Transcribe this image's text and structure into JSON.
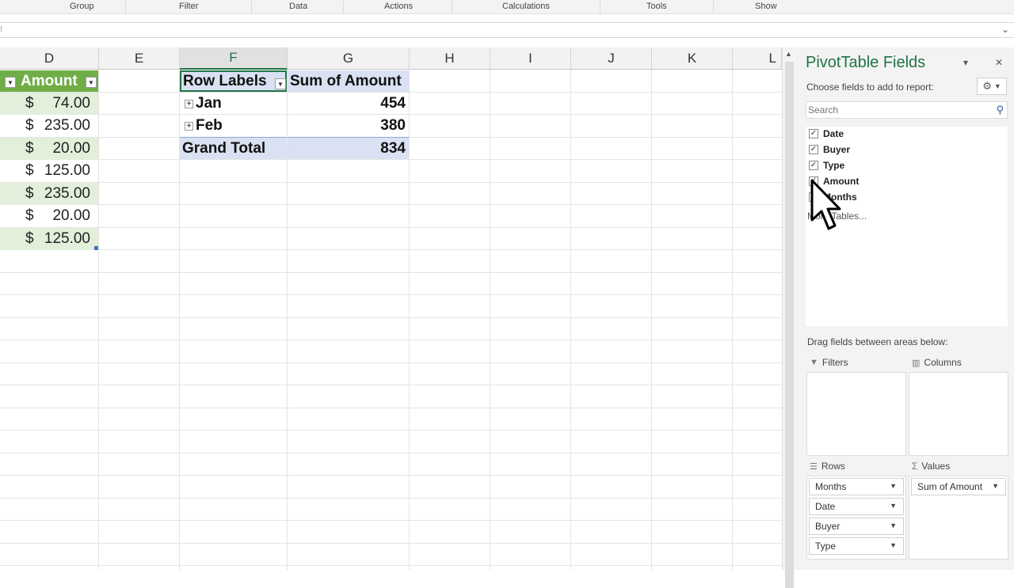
{
  "ribbon": {
    "groups": [
      "Group",
      "Filter",
      "Data",
      "Actions",
      "Calculations",
      "Tools",
      "Show"
    ]
  },
  "formula_bar": {
    "chevron": "⌄"
  },
  "columns": [
    "D",
    "E",
    "F",
    "G",
    "H",
    "I",
    "J",
    "K",
    "L"
  ],
  "table": {
    "header": "Amount",
    "currency": "$",
    "values": [
      "74.00",
      "235.00",
      "20.00",
      "125.00",
      "235.00",
      "20.00",
      "125.00"
    ]
  },
  "pivot": {
    "row_labels_header": "Row Labels",
    "sum_header": "Sum of Amount",
    "rows": [
      {
        "label": "Jan",
        "value": "454"
      },
      {
        "label": "Feb",
        "value": "380"
      }
    ],
    "grand_total_label": "Grand Total",
    "grand_total_value": "834"
  },
  "panel": {
    "title": "PivotTable Fields",
    "subtitle": "Choose fields to add to report:",
    "search_placeholder": "Search",
    "fields": [
      {
        "label": "Date",
        "checked": true
      },
      {
        "label": "Buyer",
        "checked": true
      },
      {
        "label": "Type",
        "checked": true
      },
      {
        "label": "Amount",
        "checked": true
      },
      {
        "label": "Months",
        "checked": true
      }
    ],
    "more_tables": "More Tables...",
    "drag_label": "Drag fields between areas below:",
    "areas": {
      "filters": "Filters",
      "columns": "Columns",
      "rows": "Rows",
      "values": "Values"
    },
    "rows_items": [
      "Months",
      "Date",
      "Buyer",
      "Type"
    ],
    "values_items": [
      "Sum of Amount"
    ]
  }
}
